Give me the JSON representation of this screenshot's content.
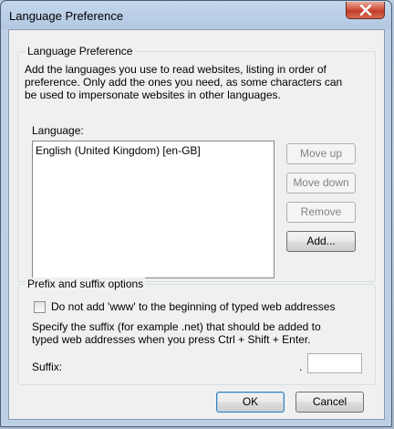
{
  "window": {
    "title": "Language Preference"
  },
  "language_group": {
    "label": "Language Preference",
    "description_lines": [
      "Add the languages you use to read websites, listing in order of",
      "preference. Only add the ones you need, as some characters can",
      "be used to impersonate websites in other languages."
    ],
    "list_label": "Language:",
    "languages": [
      "English (United Kingdom) [en-GB]"
    ],
    "buttons": {
      "move_up": "Move up",
      "move_down": "Move down",
      "remove": "Remove",
      "add": "Add..."
    }
  },
  "prefix_group": {
    "label": "Prefix and suffix options",
    "checkbox_label": "Do not add 'www' to the beginning of typed web addresses",
    "checkbox_checked": false,
    "suffix_desc_lines": [
      "Specify the suffix (for example .net) that should be added to",
      "typed web addresses when you press Ctrl + Shift + Enter."
    ],
    "suffix_label": "Suffix:",
    "suffix_dot": ".",
    "suffix_value": ""
  },
  "footer": {
    "ok": "OK",
    "cancel": "Cancel"
  }
}
